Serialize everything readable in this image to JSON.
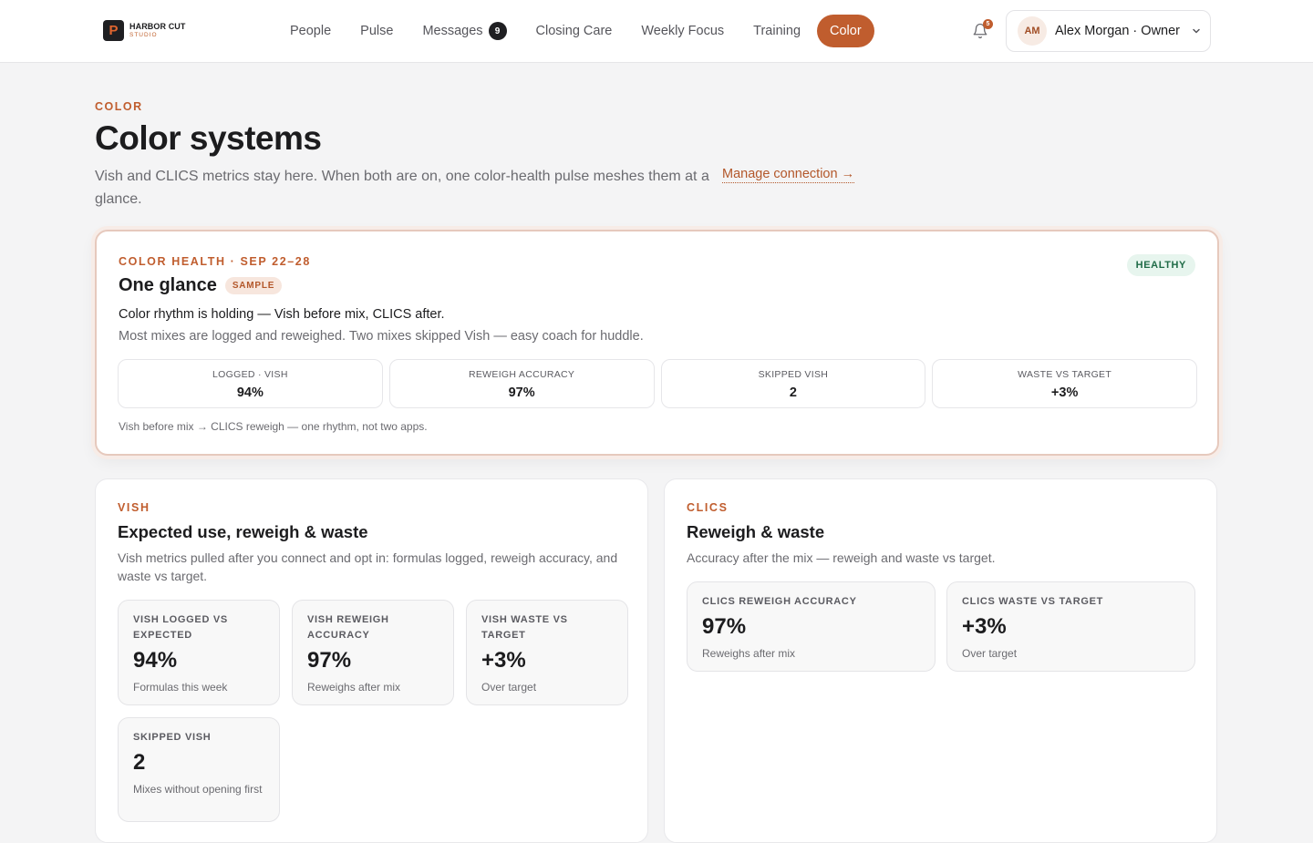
{
  "brand": {
    "mark": "P",
    "name": "HARBOR CUT",
    "sub": "STUDIO"
  },
  "nav": {
    "items": [
      {
        "label": "People"
      },
      {
        "label": "Pulse"
      },
      {
        "label": "Messages",
        "badge": "9"
      },
      {
        "label": "Closing Care"
      },
      {
        "label": "Weekly Focus"
      },
      {
        "label": "Training"
      },
      {
        "label": "Color",
        "active": true
      }
    ]
  },
  "notifications": {
    "count": "5"
  },
  "user": {
    "initials": "AM",
    "name": "Alex Morgan · Owner"
  },
  "header": {
    "eyebrow": "COLOR",
    "title": "Color systems",
    "description": "Vish and CLICS metrics stay here. When both are on, one color-health pulse meshes them at a glance.",
    "manage_link": "Manage connection →"
  },
  "glance": {
    "eyebrow": "COLOR HEALTH · SEP 22–28",
    "title": "One glance",
    "sample_tag": "SAMPLE",
    "status": "HEALTHY",
    "headline": "Color rhythm is holding — Vish before mix, CLICS after.",
    "subline": "Most mixes are logged and reweighed. Two mixes skipped Vish — easy coach for huddle.",
    "stats": [
      {
        "label": "LOGGED · VISH",
        "value": "94%"
      },
      {
        "label": "REWEIGH ACCURACY",
        "value": "97%"
      },
      {
        "label": "SKIPPED VISH",
        "value": "2"
      },
      {
        "label": "WASTE VS TARGET",
        "value": "+3%"
      }
    ],
    "footnote": "Vish before mix → CLICS reweigh — one rhythm, not two apps."
  },
  "vish": {
    "eyebrow": "VISH",
    "title": "Expected use, reweigh & waste",
    "description": "Vish metrics pulled after you connect and opt in: formulas logged, reweigh accuracy, and waste vs target.",
    "metrics": [
      {
        "label": "VISH LOGGED VS EXPECTED",
        "value": "94%",
        "caption": "Formulas this week"
      },
      {
        "label": "VISH REWEIGH ACCURACY",
        "value": "97%",
        "caption": "Reweighs after mix"
      },
      {
        "label": "VISH WASTE VS TARGET",
        "value": "+3%",
        "caption": "Over target"
      },
      {
        "label": "SKIPPED VISH",
        "value": "2",
        "caption": "Mixes without opening first"
      }
    ]
  },
  "clics": {
    "eyebrow": "CLICS",
    "title": "Reweigh & waste",
    "description": "Accuracy after the mix — reweigh and waste vs target.",
    "metrics": [
      {
        "label": "CLICS REWEIGH ACCURACY",
        "value": "97%",
        "caption": "Reweighs after mix"
      },
      {
        "label": "CLICS WASTE VS TARGET",
        "value": "+3%",
        "caption": "Over target"
      }
    ]
  },
  "colors": {
    "accent": "#c05d2e",
    "healthy_bg": "#e7f5ee",
    "healthy_text": "#1f6b47"
  }
}
